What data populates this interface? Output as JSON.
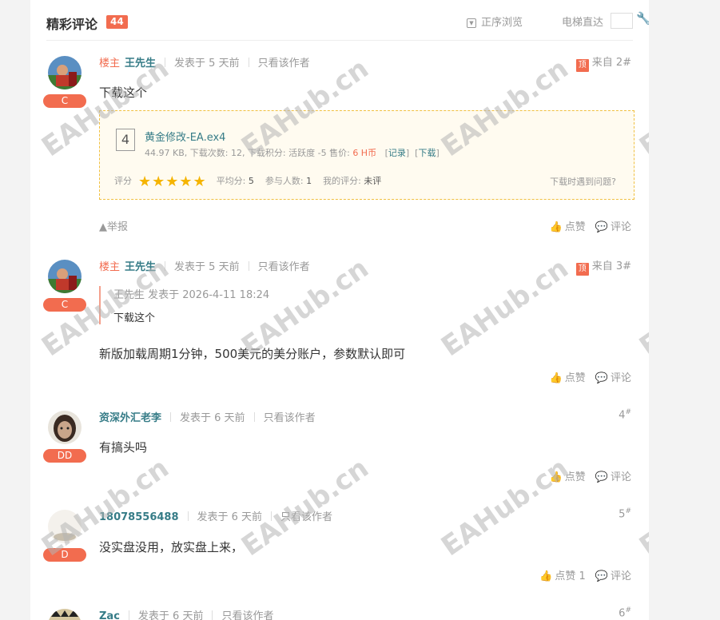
{
  "header": {
    "title": "精彩评论",
    "count": "44",
    "sort_label": "正序浏览",
    "jump_label": "电梯直达"
  },
  "posts": [
    {
      "lz": "楼主",
      "author": "王先生",
      "time": "发表于 5 天前",
      "only_author": "只看该作者",
      "top": "顶",
      "floor_text": "来自 2#",
      "level": "C",
      "text": "下载这个",
      "attachment": {
        "icon": "4",
        "name": "黄金修改-EA.ex4",
        "info_prefix": "44.97 KB, 下载次数: 12, 下载积分: 活跃度 -5 售价: ",
        "price": "6 H币",
        "record": "记录",
        "download": "下载",
        "rating_label": "评分",
        "stars": "★★★★★",
        "avg_label": "平均分: ",
        "avg": "5",
        "count_label": "参与人数: ",
        "count": "1",
        "my_label": "我的评分: ",
        "my": "未评",
        "help": "下载时遇到问题?"
      },
      "report": "举报",
      "like": "点赞",
      "comment": "评论"
    },
    {
      "lz": "楼主",
      "author": "王先生",
      "time": "发表于 5 天前",
      "only_author": "只看该作者",
      "top": "顶",
      "floor_text": "来自 3#",
      "level": "C",
      "quote_header": "王先生 发表于 2026-4-11 18:24",
      "quote_body": "下载这个",
      "text": "新版加载周期1分钟，500美元的美分账户，参数默认即可",
      "like": "点赞",
      "comment": "评论"
    },
    {
      "author": "资深外汇老李",
      "time": "发表于 6 天前",
      "only_author": "只看该作者",
      "floor": "4",
      "level": "DD",
      "text": "有搞头吗",
      "like": "点赞",
      "comment": "评论"
    },
    {
      "author": "18078556488",
      "time": "发表于 6 天前",
      "only_author": "只看该作者",
      "floor": "5",
      "level": "D",
      "text": "没实盘没用，放实盘上来，",
      "like": "点赞 1",
      "comment": "评论"
    },
    {
      "author": "Zac",
      "time": "发表于 6 天前",
      "only_author": "只看该作者",
      "floor": "6"
    }
  ],
  "watermark": "EAHub.cn",
  "icons": [
    "sort-icon",
    "wrench-icon",
    "file-icon",
    "star-icon",
    "report-icon",
    "thumbs-up-icon",
    "comment-icon"
  ],
  "colors": {
    "accent": "#f26c4f",
    "author": "#367c87",
    "star": "#f5b400",
    "attach_border": "#f0c040"
  }
}
